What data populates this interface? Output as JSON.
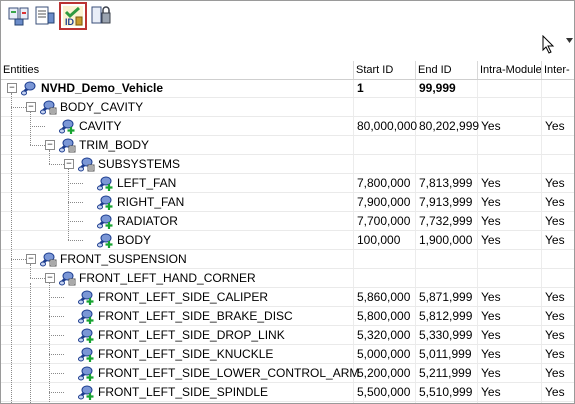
{
  "toolbar": {
    "buttons": [
      {
        "icon": "entity-report-icon"
      },
      {
        "icon": "entity-list-icon"
      },
      {
        "icon": "id-manager-icon",
        "active": true
      },
      {
        "icon": "id-locked-icon"
      }
    ]
  },
  "columns": {
    "entities": "Entities",
    "start_id": "Start ID",
    "end_id": "End ID",
    "intra_module": "Intra-Module",
    "inter": "Inter-"
  },
  "rows": [
    {
      "name": "NVHD_Demo_Vehicle",
      "bold": true,
      "level": 0,
      "start": "1",
      "end": "99,999",
      "intra": "",
      "inter": "",
      "expander": "−",
      "icon": "module-root-icon"
    },
    {
      "name": "BODY_CAVITY",
      "level": 1,
      "start": "",
      "end": "",
      "intra": "",
      "inter": "",
      "expander": "−",
      "icon": "module-group-icon"
    },
    {
      "name": "CAVITY",
      "level": 2,
      "start": "80,000,000",
      "end": "80,202,999",
      "intra": "Yes",
      "inter": "Yes",
      "expander": "",
      "icon": "module-leaf-icon"
    },
    {
      "name": "TRIM_BODY",
      "level": 2,
      "start": "",
      "end": "",
      "intra": "",
      "inter": "",
      "expander": "−",
      "icon": "module-group-icon"
    },
    {
      "name": "SUBSYSTEMS",
      "level": 3,
      "start": "",
      "end": "",
      "intra": "",
      "inter": "",
      "expander": "−",
      "icon": "module-group-icon"
    },
    {
      "name": "LEFT_FAN",
      "level": 4,
      "start": "7,800,000",
      "end": "7,813,999",
      "intra": "Yes",
      "inter": "Yes",
      "expander": "",
      "icon": "module-leaf-icon"
    },
    {
      "name": "RIGHT_FAN",
      "level": 4,
      "start": "7,900,000",
      "end": "7,913,999",
      "intra": "Yes",
      "inter": "Yes",
      "expander": "",
      "icon": "module-leaf-icon"
    },
    {
      "name": "RADIATOR",
      "level": 4,
      "start": "7,700,000",
      "end": "7,732,999",
      "intra": "Yes",
      "inter": "Yes",
      "expander": "",
      "icon": "module-leaf-icon"
    },
    {
      "name": "BODY",
      "level": 4,
      "start": "100,000",
      "end": "1,900,000",
      "intra": "Yes",
      "inter": "Yes",
      "expander": "",
      "icon": "module-leaf-icon"
    },
    {
      "name": "FRONT_SUSPENSION",
      "level": 1,
      "start": "",
      "end": "",
      "intra": "",
      "inter": "",
      "expander": "−",
      "icon": "module-group-icon"
    },
    {
      "name": "FRONT_LEFT_HAND_CORNER",
      "level": 2,
      "start": "",
      "end": "",
      "intra": "",
      "inter": "",
      "expander": "−",
      "icon": "module-group-icon"
    },
    {
      "name": "FRONT_LEFT_SIDE_CALIPER",
      "level": 3,
      "start": "5,860,000",
      "end": "5,871,999",
      "intra": "Yes",
      "inter": "Yes",
      "expander": "",
      "icon": "module-leaf-icon"
    },
    {
      "name": "FRONT_LEFT_SIDE_BRAKE_DISC",
      "level": 3,
      "start": "5,800,000",
      "end": "5,812,999",
      "intra": "Yes",
      "inter": "Yes",
      "expander": "",
      "icon": "module-leaf-icon"
    },
    {
      "name": "FRONT_LEFT_SIDE_DROP_LINK",
      "level": 3,
      "start": "5,320,000",
      "end": "5,330,999",
      "intra": "Yes",
      "inter": "Yes",
      "expander": "",
      "icon": "module-leaf-icon"
    },
    {
      "name": "FRONT_LEFT_SIDE_KNUCKLE",
      "level": 3,
      "start": "5,000,000",
      "end": "5,011,999",
      "intra": "Yes",
      "inter": "Yes",
      "expander": "",
      "icon": "module-leaf-icon"
    },
    {
      "name": "FRONT_LEFT_SIDE_LOWER_CONTROL_ARM",
      "level": 3,
      "start": "5,200,000",
      "end": "5,211,999",
      "intra": "Yes",
      "inter": "Yes",
      "expander": "",
      "icon": "module-leaf-icon"
    },
    {
      "name": "FRONT_LEFT_SIDE_SPINDLE",
      "level": 3,
      "start": "5,500,000",
      "end": "5,510,999",
      "intra": "Yes",
      "inter": "Yes",
      "expander": "",
      "icon": "module-leaf-icon"
    }
  ]
}
